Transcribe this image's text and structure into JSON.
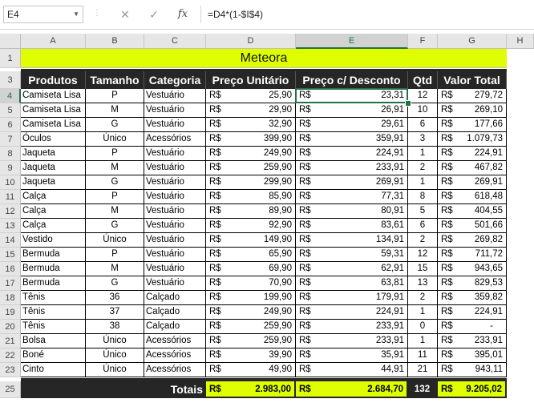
{
  "formula_bar": {
    "name_box": "E4",
    "formula": "=D4*(1-$I$4)",
    "cancel_icon": "cancel-icon",
    "enter_icon": "check-icon",
    "fx_label": "fx"
  },
  "columns": [
    "A",
    "B",
    "C",
    "D",
    "E",
    "F",
    "G",
    "H"
  ],
  "row_numbers": [
    "1",
    "3",
    "4",
    "5",
    "6",
    "7",
    "8",
    "9",
    "10",
    "11",
    "12",
    "13",
    "14",
    "15",
    "16",
    "17",
    "18",
    "19",
    "20",
    "21",
    "22",
    "23",
    "25"
  ],
  "sheet": {
    "title": "Meteora",
    "headers": [
      "Produtos",
      "Tamanho",
      "Categoria",
      "Preço Unitário",
      "Preço c/ Desconto",
      "Qtd",
      "Valor Total"
    ],
    "currency": "R$",
    "rows": [
      {
        "produto": "Camiseta Lisa",
        "tamanho": "P",
        "categoria": "Vestuário",
        "preco": "25,90",
        "desconto": "23,31",
        "qtd": "12",
        "total": "279,72"
      },
      {
        "produto": "Camiseta Lisa",
        "tamanho": "M",
        "categoria": "Vestuário",
        "preco": "29,90",
        "desconto": "26,91",
        "qtd": "10",
        "total": "269,10"
      },
      {
        "produto": "Camiseta Lisa",
        "tamanho": "G",
        "categoria": "Vestuário",
        "preco": "32,90",
        "desconto": "29,61",
        "qtd": "6",
        "total": "177,66"
      },
      {
        "produto": "Óculos",
        "tamanho": "Único",
        "categoria": "Acessórios",
        "preco": "399,90",
        "desconto": "359,91",
        "qtd": "3",
        "total": "1.079,73"
      },
      {
        "produto": "Jaqueta",
        "tamanho": "P",
        "categoria": "Vestuário",
        "preco": "249,90",
        "desconto": "224,91",
        "qtd": "1",
        "total": "224,91"
      },
      {
        "produto": "Jaqueta",
        "tamanho": "M",
        "categoria": "Vestuário",
        "preco": "259,90",
        "desconto": "233,91",
        "qtd": "2",
        "total": "467,82"
      },
      {
        "produto": "Jaqueta",
        "tamanho": "G",
        "categoria": "Vestuário",
        "preco": "299,90",
        "desconto": "269,91",
        "qtd": "1",
        "total": "269,91"
      },
      {
        "produto": "Calça",
        "tamanho": "P",
        "categoria": "Vestuário",
        "preco": "85,90",
        "desconto": "77,31",
        "qtd": "8",
        "total": "618,48"
      },
      {
        "produto": "Calça",
        "tamanho": "M",
        "categoria": "Vestuário",
        "preco": "89,90",
        "desconto": "80,91",
        "qtd": "5",
        "total": "404,55"
      },
      {
        "produto": "Calça",
        "tamanho": "G",
        "categoria": "Vestuário",
        "preco": "92,90",
        "desconto": "83,61",
        "qtd": "6",
        "total": "501,66"
      },
      {
        "produto": "Vestido",
        "tamanho": "Único",
        "categoria": "Vestuário",
        "preco": "149,90",
        "desconto": "134,91",
        "qtd": "2",
        "total": "269,82"
      },
      {
        "produto": "Bermuda",
        "tamanho": "P",
        "categoria": "Vestuário",
        "preco": "65,90",
        "desconto": "59,31",
        "qtd": "12",
        "total": "711,72"
      },
      {
        "produto": "Bermuda",
        "tamanho": "M",
        "categoria": "Vestuário",
        "preco": "69,90",
        "desconto": "62,91",
        "qtd": "15",
        "total": "943,65"
      },
      {
        "produto": "Bermuda",
        "tamanho": "G",
        "categoria": "Vestuário",
        "preco": "70,90",
        "desconto": "63,81",
        "qtd": "13",
        "total": "829,53"
      },
      {
        "produto": "Tênis",
        "tamanho": "36",
        "categoria": "Calçado",
        "preco": "199,90",
        "desconto": "179,91",
        "qtd": "2",
        "total": "359,82"
      },
      {
        "produto": "Tênis",
        "tamanho": "37",
        "categoria": "Calçado",
        "preco": "249,90",
        "desconto": "224,91",
        "qtd": "1",
        "total": "224,91"
      },
      {
        "produto": "Tênis",
        "tamanho": "38",
        "categoria": "Calçado",
        "preco": "259,90",
        "desconto": "233,91",
        "qtd": "0",
        "total": "-"
      },
      {
        "produto": "Bolsa",
        "tamanho": "Único",
        "categoria": "Acessórios",
        "preco": "259,90",
        "desconto": "233,91",
        "qtd": "1",
        "total": "233,91"
      },
      {
        "produto": "Boné",
        "tamanho": "Único",
        "categoria": "Acessórios",
        "preco": "39,90",
        "desconto": "35,91",
        "qtd": "11",
        "total": "395,01"
      },
      {
        "produto": "Cinto",
        "tamanho": "Único",
        "categoria": "Acessórios",
        "preco": "49,90",
        "desconto": "44,91",
        "qtd": "21",
        "total": "943,11"
      }
    ],
    "totals": {
      "label": "Totais",
      "preco": "2.983,00",
      "desconto": "2.684,70",
      "qtd": "132",
      "total": "9.205,02"
    }
  },
  "colors": {
    "title_bg": "#dfff00",
    "header_bg": "#262626",
    "selection": "#217346"
  }
}
